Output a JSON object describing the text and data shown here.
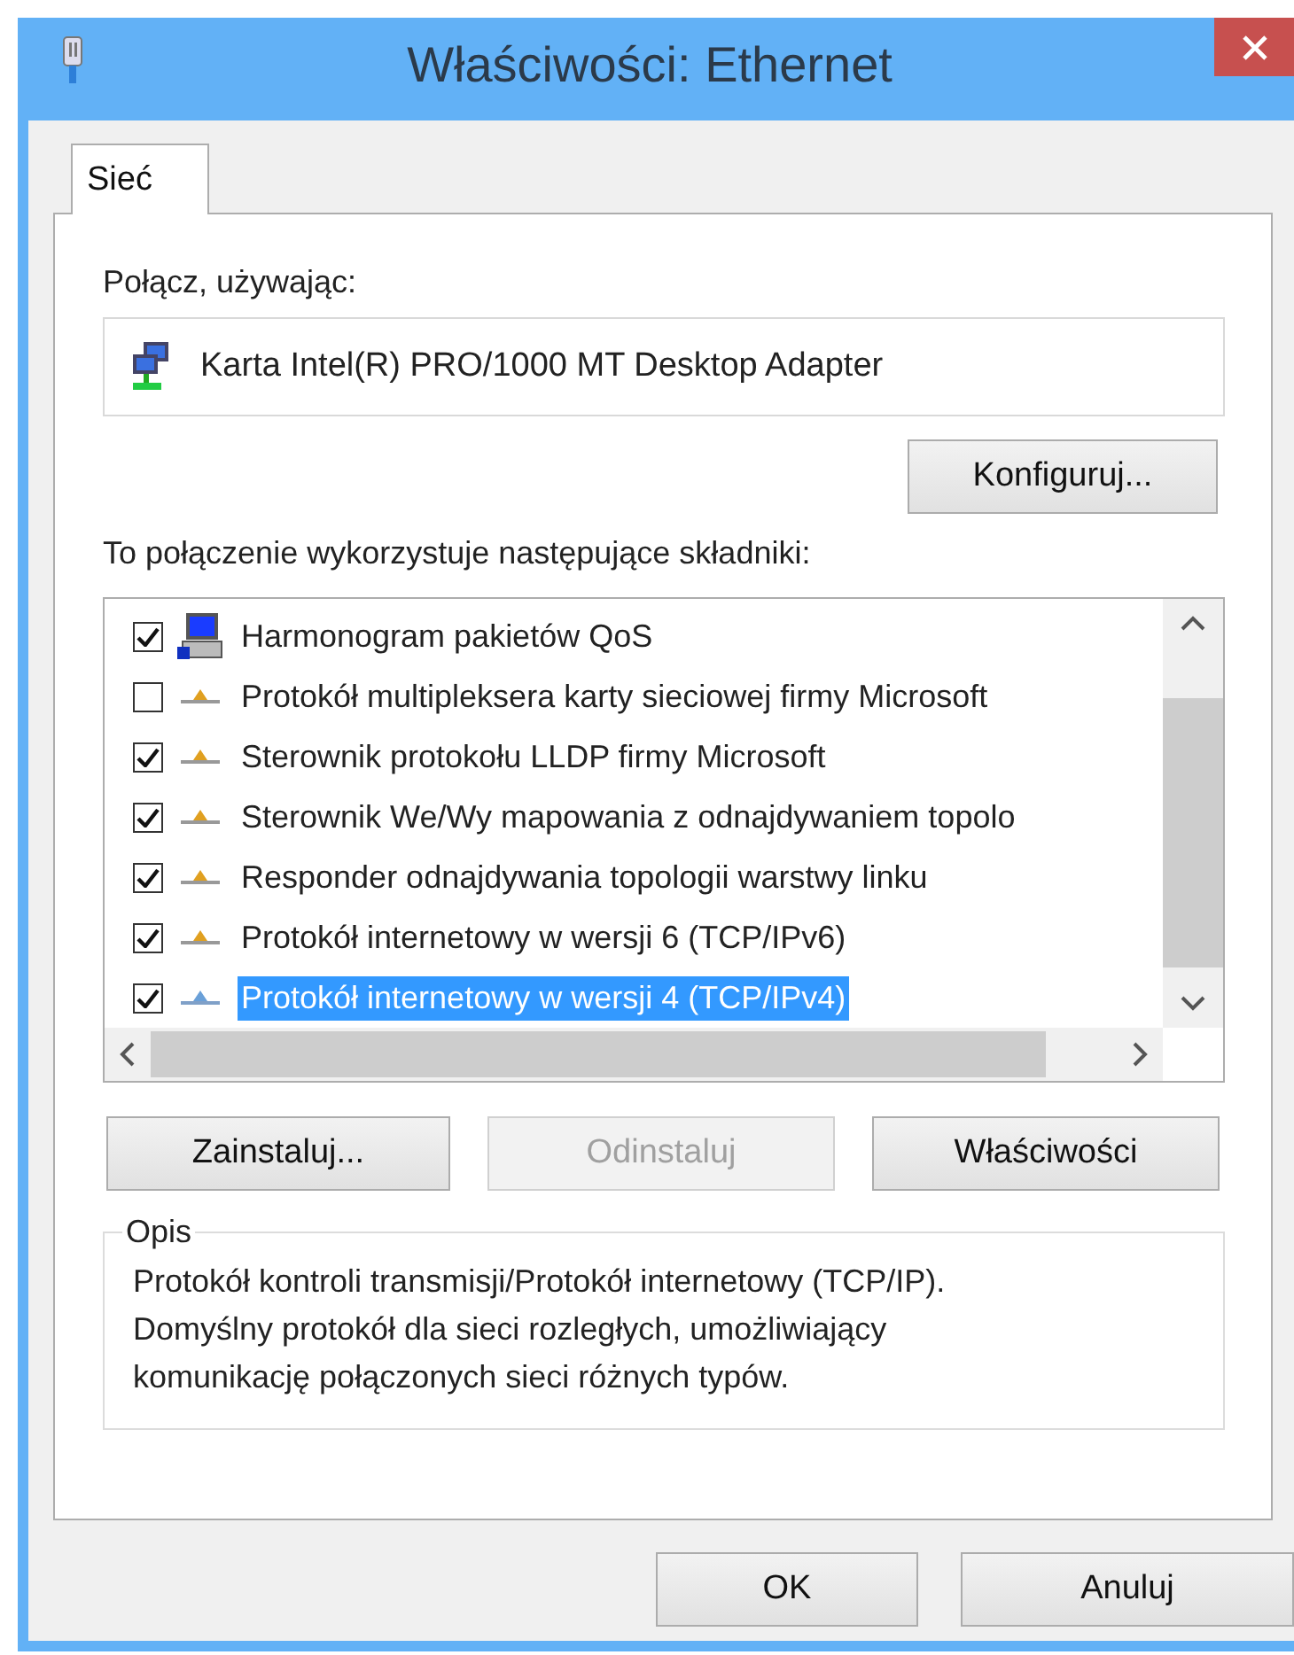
{
  "window": {
    "title": "Właściwości: Ethernet"
  },
  "tabs": [
    {
      "label": "Sieć",
      "selected": true
    }
  ],
  "connect_label": "Połącz, używając:",
  "adapter": "Karta Intel(R) PRO/1000 MT Desktop Adapter",
  "configure_button": "Konfiguruj...",
  "components_label": "To połączenie wykorzystuje następujące składniki:",
  "components": [
    {
      "kind": "scheduler",
      "label": "Harmonogram pakietów QoS",
      "checked": true,
      "selected": false
    },
    {
      "kind": "protocol",
      "label": "Protokół multipleksera karty sieciowej firmy Microsoft",
      "checked": false,
      "selected": false
    },
    {
      "kind": "protocol",
      "label": "Sterownik protokołu LLDP firmy Microsoft",
      "checked": true,
      "selected": false
    },
    {
      "kind": "protocol",
      "label": "Sterownik We/Wy mapowania z odnajdywaniem topolo",
      "checked": true,
      "selected": false
    },
    {
      "kind": "protocol",
      "label": "Responder odnajdywania topologii warstwy linku",
      "checked": true,
      "selected": false
    },
    {
      "kind": "protocol",
      "label": "Protokół internetowy w wersji 6 (TCP/IPv6)",
      "checked": true,
      "selected": false
    },
    {
      "kind": "protocol",
      "label": "Protokół internetowy w wersji 4 (TCP/IPv4)",
      "checked": true,
      "selected": true
    }
  ],
  "action_buttons": [
    {
      "label": "Zainstaluj...",
      "disabled": false
    },
    {
      "label": "Odinstaluj",
      "disabled": true
    },
    {
      "label": "Właściwości",
      "disabled": false
    }
  ],
  "description": {
    "title": "Opis",
    "text": "Protokół kontroli transmisji/Protokół internetowy (TCP/IP).\nDomyślny protokół dla sieci rozległych, umożliwiający\nkomunikację połączonych sieci różnych typów."
  },
  "dialog_buttons": [
    "OK",
    "Anuluj"
  ]
}
